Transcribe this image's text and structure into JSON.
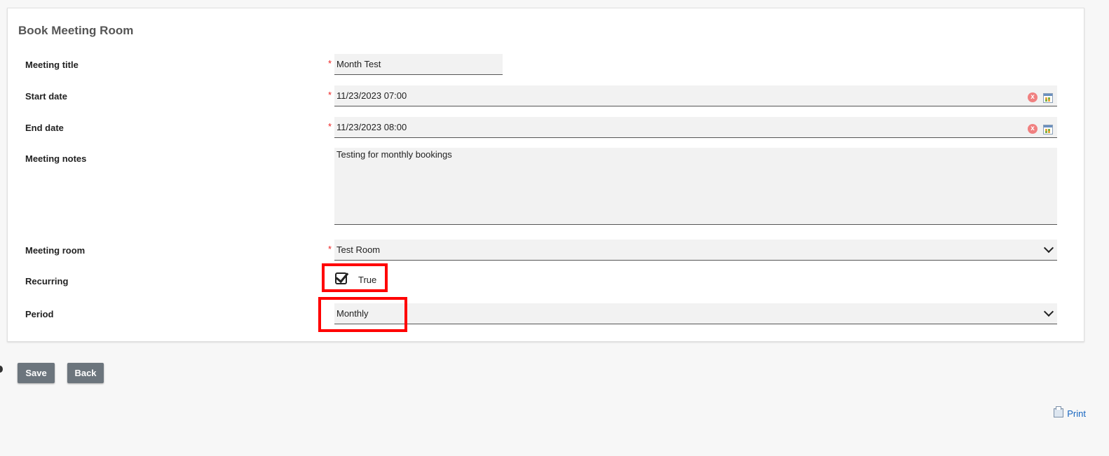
{
  "form": {
    "title": "Book Meeting Room",
    "required_marker": "*",
    "fields": {
      "meeting_title": {
        "label": "Meeting title",
        "value": "Month Test"
      },
      "start_date": {
        "label": "Start date",
        "value": "11/23/2023 07:00",
        "clear_icon": "x"
      },
      "end_date": {
        "label": "End date",
        "value": "11/23/2023 08:00",
        "clear_icon": "x"
      },
      "meeting_notes": {
        "label": "Meeting notes",
        "value": "Testing for monthly bookings"
      },
      "meeting_room": {
        "label": "Meeting room",
        "value": "Test Room"
      },
      "recurring": {
        "label": "Recurring",
        "value": "True",
        "checked": true
      },
      "period": {
        "label": "Period",
        "value": "Monthly"
      }
    }
  },
  "actions": {
    "save_label": "Save",
    "back_label": "Back"
  },
  "footer": {
    "print_label": "Print"
  },
  "colors": {
    "highlight": "#ff0000",
    "button_bg": "#6c757d",
    "link": "#1565c0",
    "required": "#ee2222"
  },
  "icons": [
    "clear-icon",
    "calendar-icon",
    "chevron-down-icon",
    "checkbox-checked-icon",
    "printer-icon"
  ]
}
